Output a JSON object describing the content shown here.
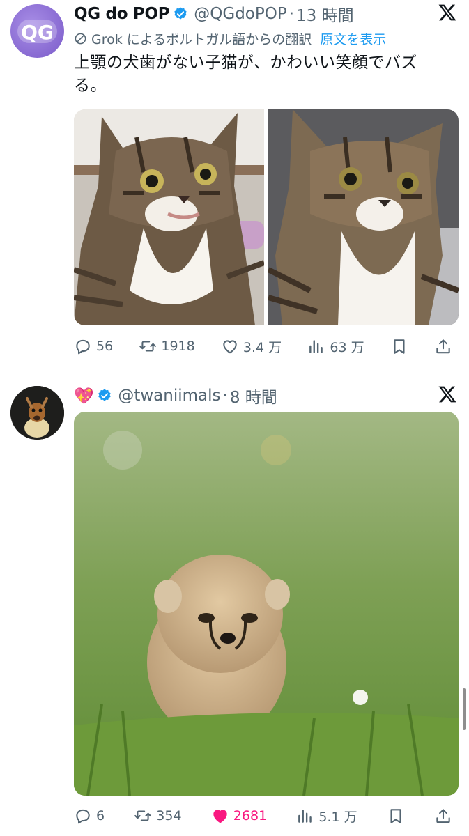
{
  "tweets": [
    {
      "display_name": "QG do POP",
      "handle": "@QGdoPOP",
      "dot": "·",
      "time": "13 時間",
      "translation_note": "Grok によるポルトガル語からの翻訳",
      "show_original": "原文を表示",
      "text": "上顎の犬歯がない子猫が、かわいい笑顔でバズる。",
      "replies": "56",
      "retweets": "1918",
      "likes": "3.4 万",
      "views": "63 万",
      "liked": false
    },
    {
      "display_name": "💖",
      "handle": "@twaniimals",
      "dot": "·",
      "time": "8 時間",
      "replies": "6",
      "retweets": "354",
      "likes": "2681",
      "views": "5.1 万",
      "liked": true
    }
  ],
  "avatar_text": "QG",
  "colors": {
    "accent_blue": "#1d9bf0",
    "like_pink": "#f91880",
    "muted_text": "#536471",
    "divider": "#e3e6e9"
  },
  "icons": [
    "verified-badge-icon",
    "x-logo-icon",
    "globe-icon",
    "reply-icon",
    "retweet-icon",
    "like-icon",
    "views-icon",
    "bookmark-icon",
    "share-icon"
  ]
}
